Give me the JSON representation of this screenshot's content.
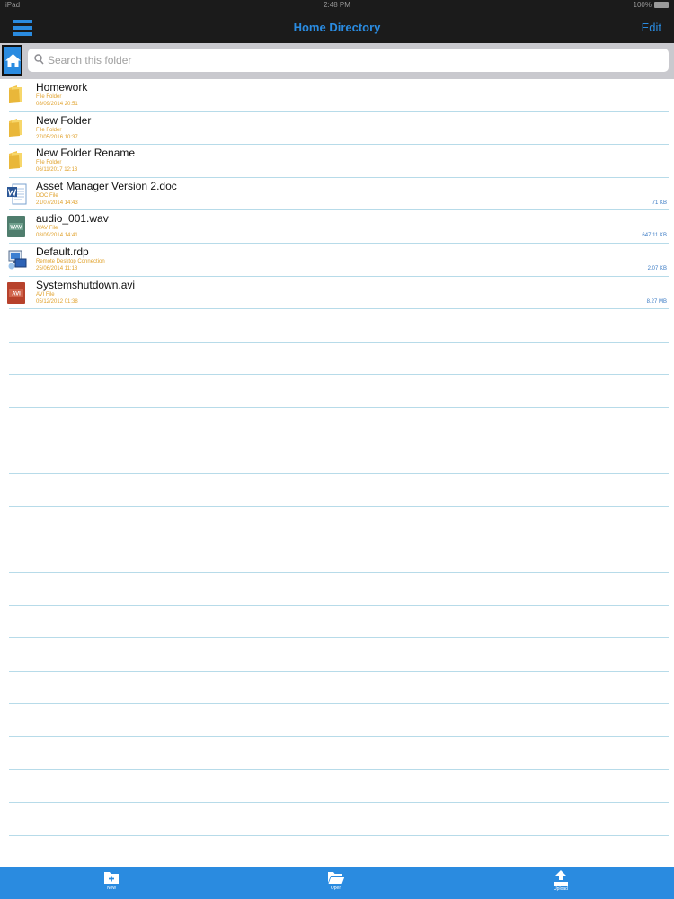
{
  "status_bar": {
    "carrier": "iPad",
    "time": "2:48 PM",
    "battery": "100%"
  },
  "nav": {
    "title": "Home Directory",
    "edit_label": "Edit"
  },
  "search": {
    "placeholder": "Search this folder"
  },
  "files": [
    {
      "name": "Homework",
      "type": "File Folder",
      "date": "08/09/2014 20:51",
      "size": "",
      "icon": "folder-icon"
    },
    {
      "name": "New Folder",
      "type": "File Folder",
      "date": "27/05/2016 10:37",
      "size": "",
      "icon": "folder-icon"
    },
    {
      "name": "New Folder Rename",
      "type": "File Folder",
      "date": "06/11/2017 12:13",
      "size": "",
      "icon": "folder-icon"
    },
    {
      "name": "Asset Manager Version 2.doc",
      "type": "DOC File",
      "date": "21/07/2014 14:43",
      "size": "71 KB",
      "icon": "doc-file-icon"
    },
    {
      "name": "audio_001.wav",
      "type": "WAV File",
      "date": "08/09/2014 14:41",
      "size": "647.11 KB",
      "icon": "wav-file-icon"
    },
    {
      "name": "Default.rdp",
      "type": "Remote Desktop Connection",
      "date": "25/06/2014 11:18",
      "size": "2.07 KB",
      "icon": "rdp-file-icon"
    },
    {
      "name": "Systemshutdown.avi",
      "type": "AVI File",
      "date": "05/12/2012 01:38",
      "size": "8.27 MB",
      "icon": "avi-file-icon"
    }
  ],
  "icon_labels": {
    "wav": "WAV",
    "avi": "AVI"
  },
  "toolbar": {
    "new_label": "New",
    "open_label": "Open",
    "upload_label": "Upload"
  },
  "colors": {
    "accent": "#2a8be0",
    "nav_background": "#1b1b1b",
    "meta_text": "#e0a12b",
    "row_divider": "#b7dbe9"
  }
}
